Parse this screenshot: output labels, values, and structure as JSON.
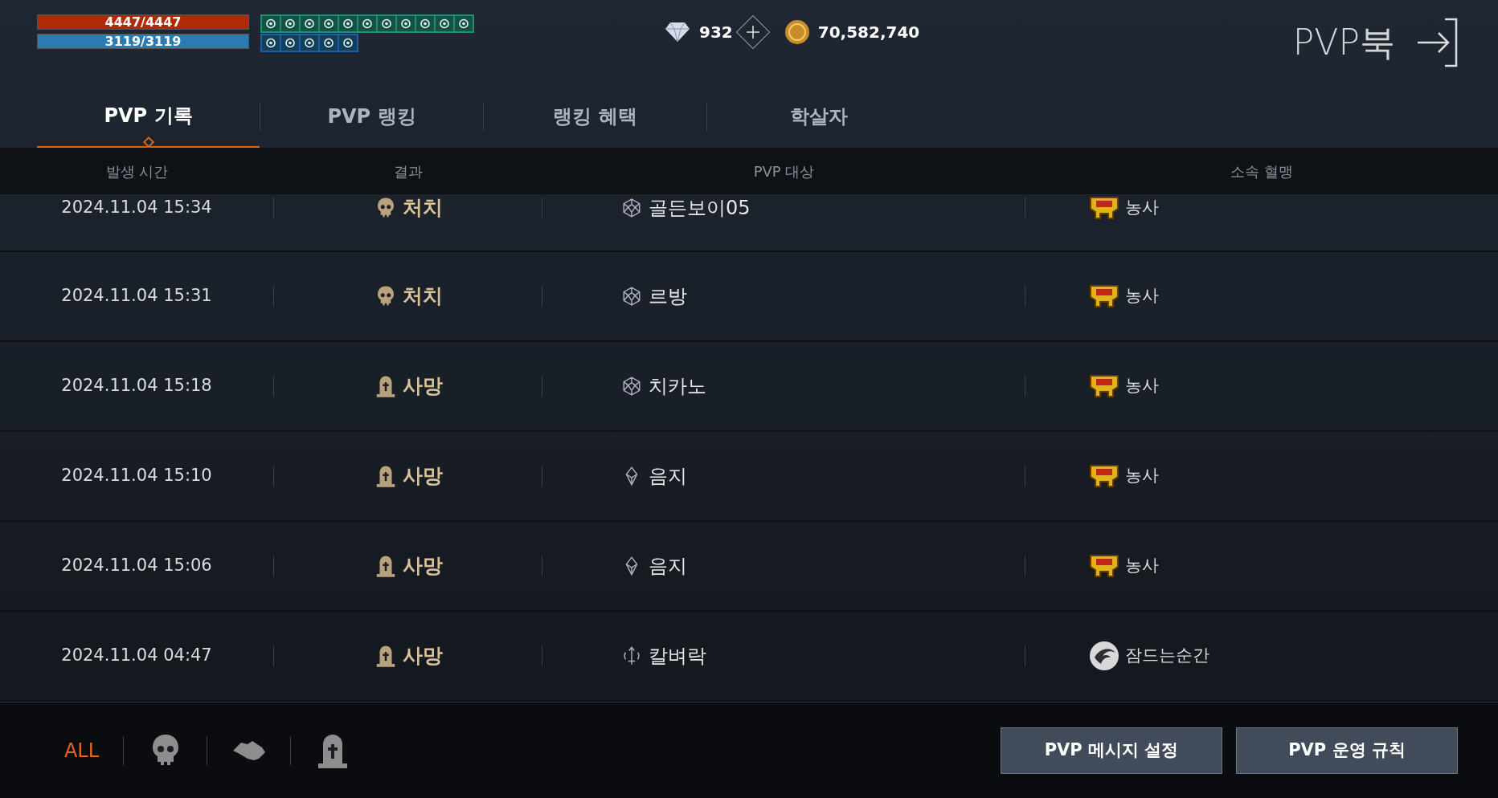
{
  "hp": {
    "text": "4447/4447",
    "level": 1
  },
  "mp": {
    "text": "3119/3119",
    "level": 1
  },
  "currency": {
    "gems": "932",
    "coins": "70,582,740"
  },
  "title": "PVP북",
  "tabs": [
    {
      "label": "PVP 기록",
      "selected": true
    },
    {
      "label": "PVP 랭킹",
      "selected": false
    },
    {
      "label": "랭킹 혜택",
      "selected": false
    },
    {
      "label": "학살자",
      "selected": false
    }
  ],
  "columns": [
    "발생 시간",
    "결과",
    "PVP 대상",
    "소속 혈맹"
  ],
  "rows": [
    {
      "time": "2024.11.04 15:34",
      "result": {
        "kind": "kill",
        "text": "처치"
      },
      "target": {
        "kind": "polyhedron",
        "text": "골든보이05"
      },
      "clan": {
        "kind": "crest",
        "text": "농사"
      }
    },
    {
      "time": "2024.11.04 15:31",
      "result": {
        "kind": "kill",
        "text": "처치"
      },
      "target": {
        "kind": "polyhedron",
        "text": "르방"
      },
      "clan": {
        "kind": "crest",
        "text": "농사"
      }
    },
    {
      "time": "2024.11.04 15:18",
      "result": {
        "kind": "death",
        "text": "사망"
      },
      "target": {
        "kind": "polyhedron",
        "text": "치카노"
      },
      "clan": {
        "kind": "crest",
        "text": "농사"
      }
    },
    {
      "time": "2024.11.04 15:10",
      "result": {
        "kind": "death",
        "text": "사망"
      },
      "target": {
        "kind": "crystal",
        "text": "음지"
      },
      "clan": {
        "kind": "crest",
        "text": "농사"
      }
    },
    {
      "time": "2024.11.04 15:06",
      "result": {
        "kind": "death",
        "text": "사망"
      },
      "target": {
        "kind": "crystal",
        "text": "음지"
      },
      "clan": {
        "kind": "crest",
        "text": "농사"
      }
    },
    {
      "time": "2024.11.04 04:47",
      "result": {
        "kind": "death",
        "text": "사망"
      },
      "target": {
        "kind": "sword",
        "text": "칼벼락"
      },
      "clan": {
        "kind": "claw",
        "text": "잠드는순간"
      }
    }
  ],
  "filters": [
    {
      "kind": "all",
      "label": "ALL",
      "selected": true
    },
    {
      "kind": "kill",
      "selected": false
    },
    {
      "kind": "truce",
      "selected": false
    },
    {
      "kind": "death",
      "selected": false
    }
  ],
  "buttons": [
    "PVP 메시지 설정",
    "PVP 운영 규칙"
  ]
}
